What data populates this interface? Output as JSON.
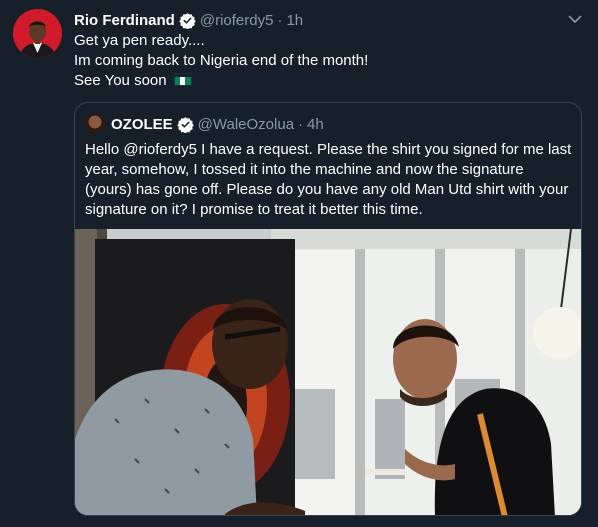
{
  "tweet": {
    "display_name": "Rio Ferdinand",
    "handle": "@rioferdy5",
    "separator": "·",
    "time": "1h",
    "verified_icon": "verified-badge-icon",
    "menu_icon": "chevron-down-icon",
    "lines": [
      "Get ya pen ready....",
      "Im coming back to Nigeria end of the month!",
      "See You soon"
    ],
    "flag": {
      "name": "nigeria-flag",
      "colors": [
        "#008751",
        "#ffffff",
        "#008751"
      ]
    }
  },
  "quote": {
    "display_name": "OZOLEE",
    "handle": "@WaleOzolua",
    "separator": "·",
    "time": "4h",
    "lines": [
      "Hello @rioferdy5 I have a request. Please the shirt you signed for me last",
      "year, somehow, I tossed it into the machine and now the signature",
      "(yours) has gone off. Please do you have any old Man Utd shirt with your",
      "signature on it? I promise to treat it better this time."
    ]
  },
  "colors": {
    "background": "#15202b",
    "text": "#ffffff",
    "secondary_text": "#8899a6",
    "border": "#38444d",
    "verified": "#ffffff"
  }
}
